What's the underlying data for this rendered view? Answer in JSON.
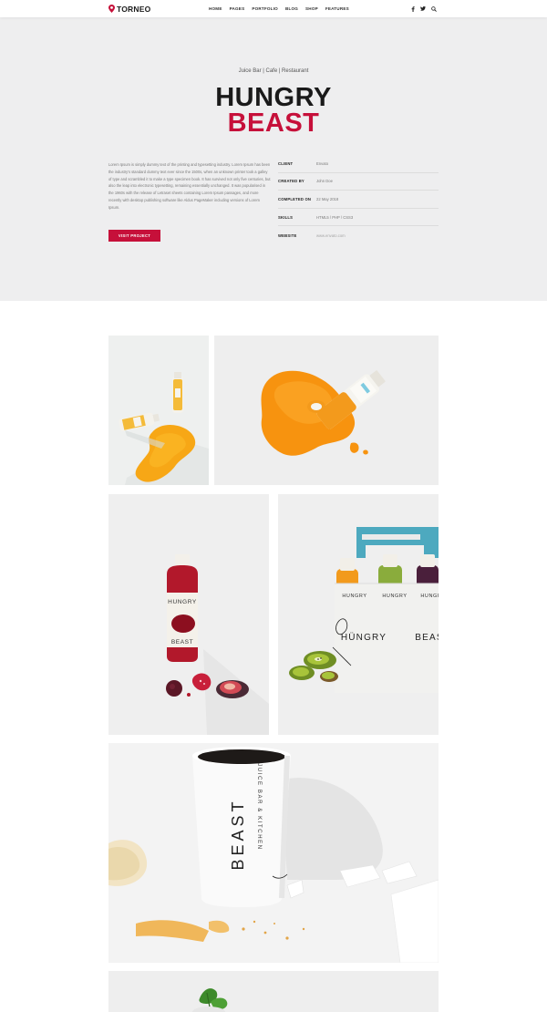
{
  "header": {
    "logo": "TORNEO",
    "nav": [
      "HOME",
      "PAGES",
      "PORTFOLIO",
      "BLOG",
      "SHOP",
      "FEATURES"
    ],
    "icons": [
      "facebook-icon",
      "twitter-icon",
      "search-icon"
    ]
  },
  "hero": {
    "subtitle": "Juice Bar | Cafe | Restaurant",
    "title_line1": "HUNGRY",
    "title_line2": "BEAST",
    "description": "Lorem Ipsum is simply dummy text of the printing and typesetting industry. Lorem Ipsum has been the industry's standard dummy text ever since the 1500s, when an unknown printer took a galley of type and scrambled it to make a type specimen book. It has survived not only five centuries, but also the leap into electronic typesetting, remaining essentially unchanged. It was popularised in the 1960s with the release of Letraset sheets containing Lorem Ipsum passages, and more recently with desktop publishing software like Aldus PageMaker including versions of Lorem Ipsum.",
    "button_label": "VISIT PROJECT"
  },
  "meta": [
    {
      "label": "CLIENT",
      "value": "Envato"
    },
    {
      "label": "CREATED BY",
      "value": "John Doe"
    },
    {
      "label": "COMPLETED ON",
      "value": "22 May 2018"
    },
    {
      "label": "SKILLS",
      "value": "HTML5 / PHP / CSS3"
    },
    {
      "label": "WEBSITE",
      "value": "www.envato.com"
    }
  ],
  "gallery": {
    "bottle_label_top": "HUNGRY",
    "bottle_label_bottom": "BEAST",
    "box_text_left": "HÜNGRY",
    "box_text_right": "BEAS",
    "cup_text_small": "JUICE BAR & KITCHEN",
    "cup_text_big": "BEAST"
  },
  "colors": {
    "accent": "#c6103a",
    "hero_bg": "#eeeeef"
  }
}
